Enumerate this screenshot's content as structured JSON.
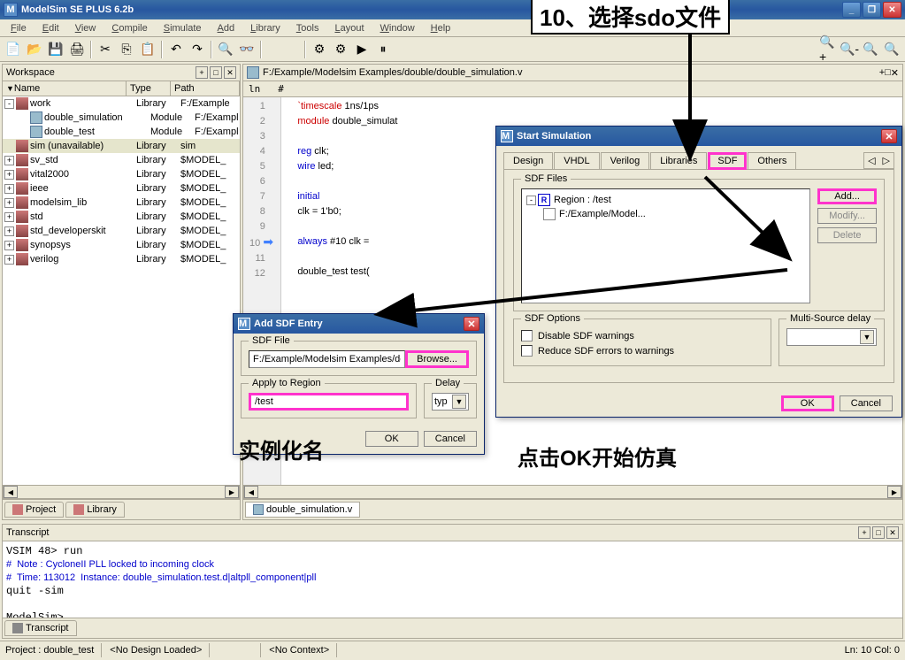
{
  "app": {
    "title": "ModelSim SE PLUS 6.2b",
    "icon": "M"
  },
  "menu": [
    "File",
    "Edit",
    "View",
    "Compile",
    "Simulate",
    "Add",
    "Library",
    "Tools",
    "Layout",
    "Window",
    "Help"
  ],
  "workspace": {
    "title": "Workspace",
    "columns": [
      "Name",
      "Type",
      "Path"
    ],
    "rows": [
      {
        "indent": 0,
        "exp": "-",
        "icon": "lib",
        "name": "work",
        "type": "Library",
        "path": "F:/Example"
      },
      {
        "indent": 1,
        "exp": "",
        "icon": "mod",
        "name": "double_simulation",
        "type": "Module",
        "path": "F:/Example"
      },
      {
        "indent": 1,
        "exp": "",
        "icon": "mod",
        "name": "double_test",
        "type": "Module",
        "path": "F:/Example"
      },
      {
        "indent": 0,
        "exp": "",
        "icon": "lib",
        "name": "sim (unavailable)",
        "type": "Library",
        "path": "sim",
        "selected": true
      },
      {
        "indent": 0,
        "exp": "+",
        "icon": "lib",
        "name": "sv_std",
        "type": "Library",
        "path": "$MODEL_"
      },
      {
        "indent": 0,
        "exp": "+",
        "icon": "lib",
        "name": "vital2000",
        "type": "Library",
        "path": "$MODEL_"
      },
      {
        "indent": 0,
        "exp": "+",
        "icon": "lib",
        "name": "ieee",
        "type": "Library",
        "path": "$MODEL_"
      },
      {
        "indent": 0,
        "exp": "+",
        "icon": "lib",
        "name": "modelsim_lib",
        "type": "Library",
        "path": "$MODEL_"
      },
      {
        "indent": 0,
        "exp": "+",
        "icon": "lib",
        "name": "std",
        "type": "Library",
        "path": "$MODEL_"
      },
      {
        "indent": 0,
        "exp": "+",
        "icon": "lib",
        "name": "std_developerskit",
        "type": "Library",
        "path": "$MODEL_"
      },
      {
        "indent": 0,
        "exp": "+",
        "icon": "lib",
        "name": "synopsys",
        "type": "Library",
        "path": "$MODEL_"
      },
      {
        "indent": 0,
        "exp": "+",
        "icon": "lib",
        "name": "verilog",
        "type": "Library",
        "path": "$MODEL_"
      }
    ],
    "tabs": [
      "Project",
      "Library"
    ]
  },
  "editor": {
    "file_path": "F:/Example/Modelsim Examples/double/double_simulation.v",
    "header": {
      "ln": "ln",
      "hash": "#"
    },
    "lines": [
      {
        "n": "1",
        "code": [
          {
            "c": "kw-red",
            "t": "`timescale"
          },
          {
            "c": "",
            "t": " 1ns/1ps"
          }
        ]
      },
      {
        "n": "2",
        "code": [
          {
            "c": "kw-red",
            "t": "module"
          },
          {
            "c": "",
            "t": " double_simulat"
          }
        ]
      },
      {
        "n": "3",
        "code": [
          {
            "c": "",
            "t": ""
          }
        ]
      },
      {
        "n": "4",
        "code": [
          {
            "c": "kw-blue",
            "t": "reg"
          },
          {
            "c": "",
            "t": " clk;"
          }
        ]
      },
      {
        "n": "5",
        "code": [
          {
            "c": "kw-blue",
            "t": "wire"
          },
          {
            "c": "",
            "t": " led;"
          }
        ]
      },
      {
        "n": "6",
        "code": [
          {
            "c": "",
            "t": ""
          }
        ]
      },
      {
        "n": "7",
        "code": [
          {
            "c": "kw-blue",
            "t": "initial"
          }
        ]
      },
      {
        "n": "8",
        "code": [
          {
            "c": "",
            "t": "clk = 1'b0;"
          }
        ]
      },
      {
        "n": "9",
        "code": [
          {
            "c": "",
            "t": ""
          }
        ]
      },
      {
        "n": "10",
        "arrow": true,
        "code": [
          {
            "c": "kw-blue",
            "t": "always"
          },
          {
            "c": "",
            "t": " #10 clk = "
          }
        ]
      },
      {
        "n": "11",
        "code": [
          {
            "c": "",
            "t": ""
          }
        ]
      },
      {
        "n": "12",
        "code": [
          {
            "c": "",
            "t": "double_test test("
          }
        ]
      }
    ],
    "tab_label": "double_simulation.v"
  },
  "start_sim": {
    "title": "Start Simulation",
    "tabs": [
      "Design",
      "VHDL",
      "Verilog",
      "Libraries",
      "SDF",
      "Others"
    ],
    "active_tab": "SDF",
    "sdf_files_label": "SDF Files",
    "region_label": "Region : /test",
    "file_label": "F:/Example/Model...",
    "buttons": {
      "add": "Add...",
      "modify": "Modify...",
      "delete": "Delete"
    },
    "options_label": "SDF Options",
    "opt1": "Disable SDF warnings",
    "opt2": "Reduce SDF errors to warnings",
    "multi_source_label": "Multi-Source delay",
    "ok": "OK",
    "cancel": "Cancel"
  },
  "add_sdf": {
    "title": "Add SDF Entry",
    "sdf_file_label": "SDF File",
    "path": "F:/Example/Modelsim Examples/double",
    "browse": "Browse...",
    "apply_label": "Apply to Region",
    "region": "/test",
    "delay_label": "Delay",
    "delay_val": "typ",
    "ok": "OK",
    "cancel": "Cancel"
  },
  "transcript": {
    "title": "Transcript",
    "lines": [
      {
        "c": "",
        "t": "VSIM 48> run"
      },
      {
        "c": "t-blue",
        "t": "#  Note : CycloneII PLL locked to incoming clock"
      },
      {
        "c": "t-blue",
        "t": "#  Time: 113012  Instance: double_simulation.test.d|altpll_component|pll"
      },
      {
        "c": "",
        "t": "quit -sim"
      },
      {
        "c": "",
        "t": ""
      },
      {
        "c": "",
        "t": "ModelSim>"
      }
    ],
    "tab": "Transcript"
  },
  "status": {
    "project": "Project : double_test",
    "design": "<No Design Loaded>",
    "context": "<No Context>",
    "pos": "Ln: 10 Col: 0"
  },
  "annotations": {
    "top": "10、选择sdo文件",
    "instance": "实例化名",
    "click_ok": "点击OK开始仿真"
  }
}
